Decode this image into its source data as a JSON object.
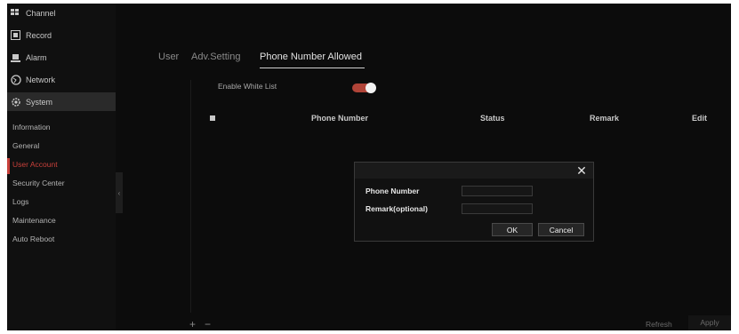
{
  "sidebar": {
    "menu": [
      {
        "label": "Channel",
        "icon": "channel-icon"
      },
      {
        "label": "Record",
        "icon": "record-icon"
      },
      {
        "label": "Alarm",
        "icon": "alarm-icon"
      },
      {
        "label": "Network",
        "icon": "network-icon"
      },
      {
        "label": "System",
        "icon": "gear-icon"
      }
    ],
    "submenu": [
      {
        "label": "Information"
      },
      {
        "label": "General"
      },
      {
        "label": "User Account"
      },
      {
        "label": "Security Center"
      },
      {
        "label": "Logs"
      },
      {
        "label": "Maintenance"
      },
      {
        "label": "Auto Reboot"
      }
    ],
    "active_submenu": "User Account"
  },
  "tabs": [
    {
      "label": "User"
    },
    {
      "label": "Adv.Setting"
    },
    {
      "label": "Phone Number Allowed"
    }
  ],
  "active_tab": "Phone Number Allowed",
  "white_list": {
    "label": "Enable White List",
    "enabled": true
  },
  "table": {
    "columns": [
      "Phone Number",
      "Status",
      "Remark",
      "Edit"
    ]
  },
  "dialog": {
    "phone_label": "Phone Number",
    "phone_value": "",
    "remark_label": "Remark(optional)",
    "remark_value": "",
    "ok": "OK",
    "cancel": "Cancel"
  },
  "footer": {
    "add_symbol": "+",
    "remove_symbol": "−",
    "refresh": "Refresh",
    "apply": "Apply"
  },
  "colors": {
    "accent": "#c8403a",
    "toggle_on": "#b04438",
    "background": "#0c0c0c"
  }
}
